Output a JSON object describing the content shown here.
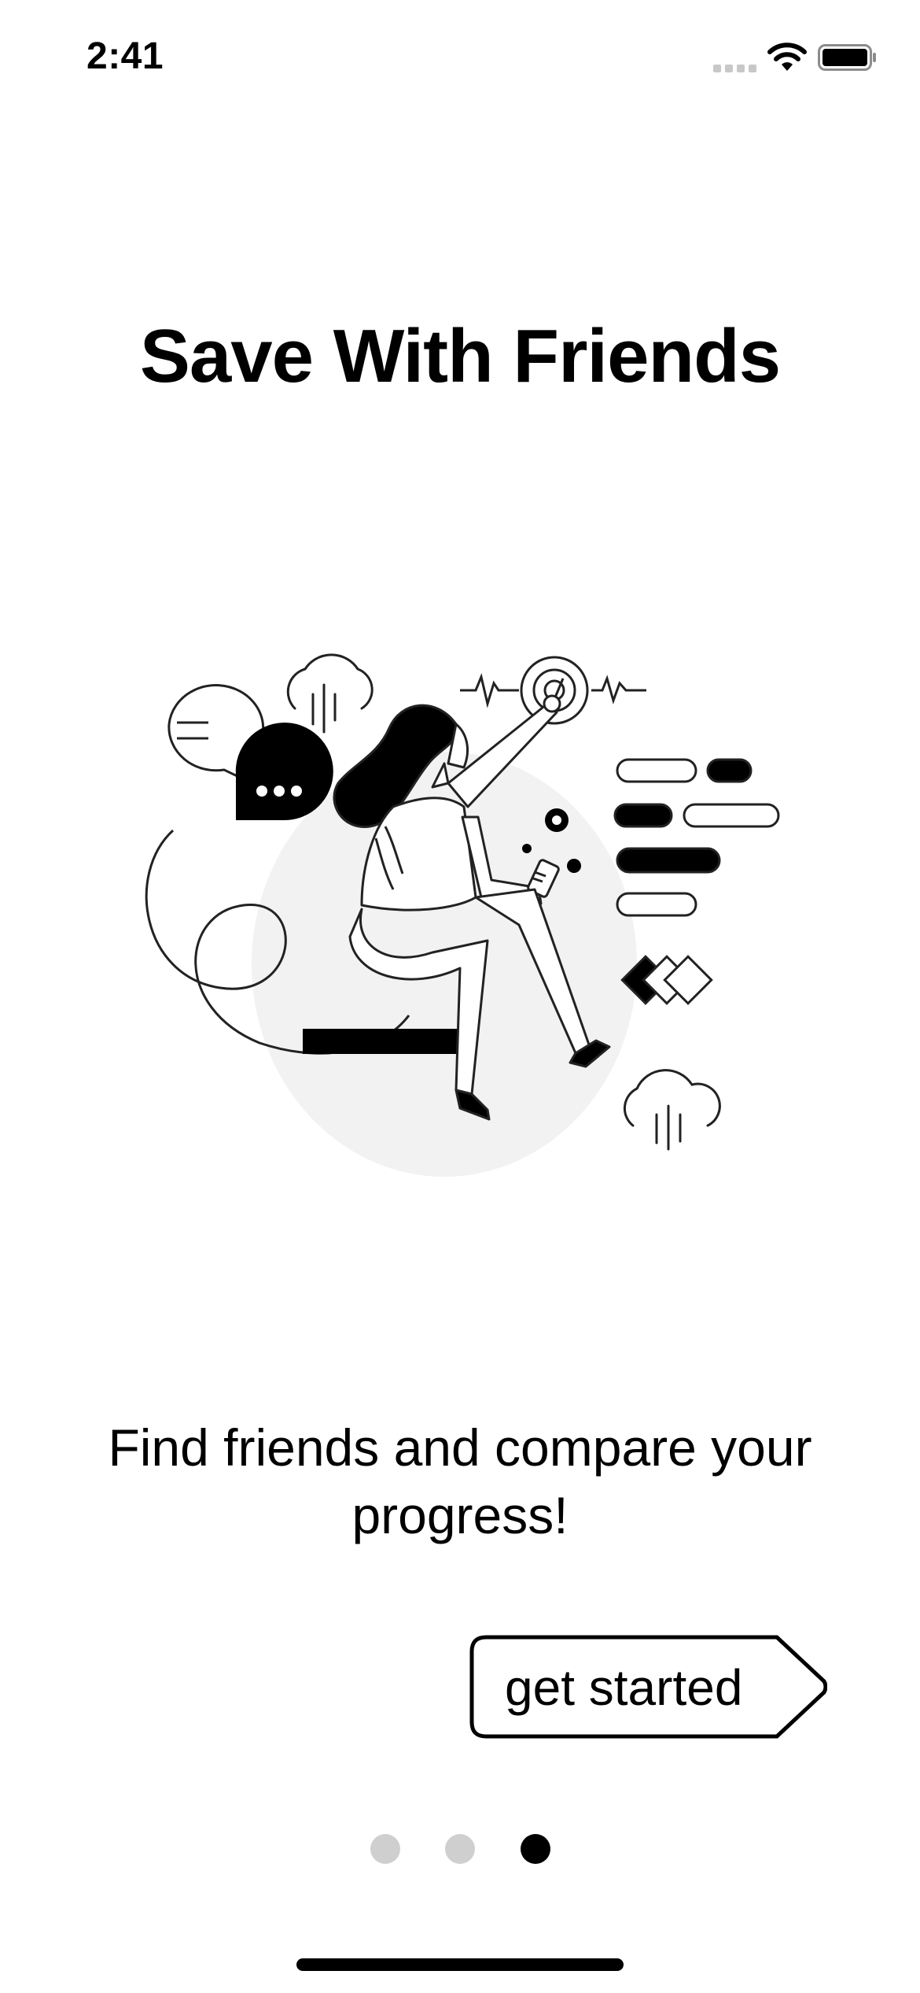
{
  "status_bar": {
    "time": "2:41",
    "icons": [
      "signal-icon",
      "wifi-icon",
      "battery-icon"
    ]
  },
  "onboarding": {
    "title": "Save With Friends",
    "description": "Find friends and compare your progress!",
    "cta_label": "get started",
    "illustration": "woman-with-phone-illustration",
    "page_indicator": {
      "total": 3,
      "current": 3
    }
  },
  "colors": {
    "background": "#ffffff",
    "foreground": "#000000",
    "dot_inactive": "#cfcfcf",
    "blob": "#f2f2f2"
  }
}
